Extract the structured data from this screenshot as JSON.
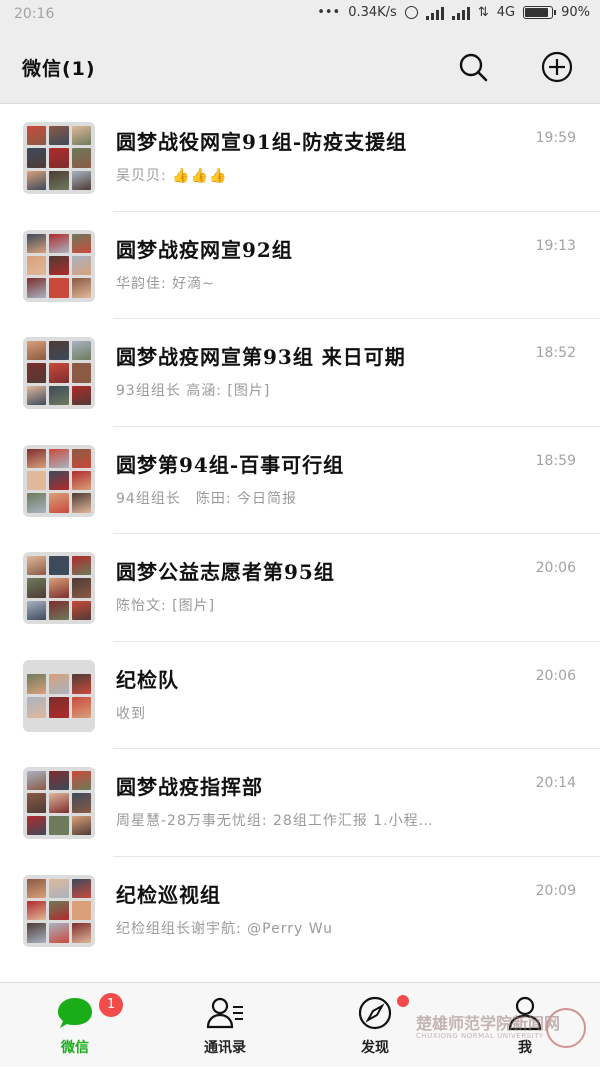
{
  "status_bar": {
    "time": "20:16",
    "dots": "•••",
    "speed": "0.34K/s",
    "network": "4G",
    "battery": "90%",
    "battery_level": 0.9
  },
  "header": {
    "title": "微信(1)",
    "search_icon": "search-icon",
    "add_icon": "plus-circle-icon"
  },
  "chats": [
    {
      "name": "圆梦战役网宣91组-防疫支援组",
      "preview": "吴贝贝: 👍👍👍",
      "time": "19:59",
      "grid": 9
    },
    {
      "name": "圆梦战疫网宣92组",
      "preview": "华韵佳: 好滴~",
      "time": "19:13",
      "grid": 9
    },
    {
      "name": "圆梦战疫网宣第93组 来日可期",
      "preview": "93组组长 高涵: [图片]",
      "time": "18:52",
      "grid": 9
    },
    {
      "name": "圆梦第94组-百事可行组",
      "preview": "94组组长　陈田: 今日简报",
      "time": "18:59",
      "grid": 9
    },
    {
      "name": "圆梦公益志愿者第95组",
      "preview": "陈怡文: [图片]",
      "time": "20:06",
      "grid": 9
    },
    {
      "name": "纪检队",
      "preview": "收到",
      "time": "20:06",
      "grid": 6
    },
    {
      "name": "圆梦战疫指挥部",
      "preview": "周星慧-28万事无忧组: 28组工作汇报 1.小程…",
      "time": "20:14",
      "grid": 9
    },
    {
      "name": "纪检巡视组",
      "preview": "纪检组组长谢宇航: @Perry Wu",
      "time": "20:09",
      "grid": 9
    }
  ],
  "tabs": [
    {
      "label": "微信",
      "icon": "chat-bubble-icon",
      "badge": "1",
      "active": true
    },
    {
      "label": "通讯录",
      "icon": "contacts-icon",
      "active": false
    },
    {
      "label": "发现",
      "icon": "compass-icon",
      "dot": true,
      "active": false
    },
    {
      "label": "我",
      "icon": "person-icon",
      "active": false
    }
  ],
  "watermark": {
    "text": "楚雄师范学院",
    "sub": "CHUXIONG NORMAL UNIVERSITY",
    "news": "新闻网"
  },
  "colors": {
    "accent": "#1aad19",
    "badge": "#f14b4b",
    "header_bg": "#ededed",
    "tile_palette": [
      "#c94a3c",
      "#8a5a44",
      "#e0b89a",
      "#3d4a5c",
      "#b02b2b",
      "#6d7b5c",
      "#d9a07a",
      "#4e3b35",
      "#a8b3c2",
      "#7c2d2d"
    ]
  }
}
